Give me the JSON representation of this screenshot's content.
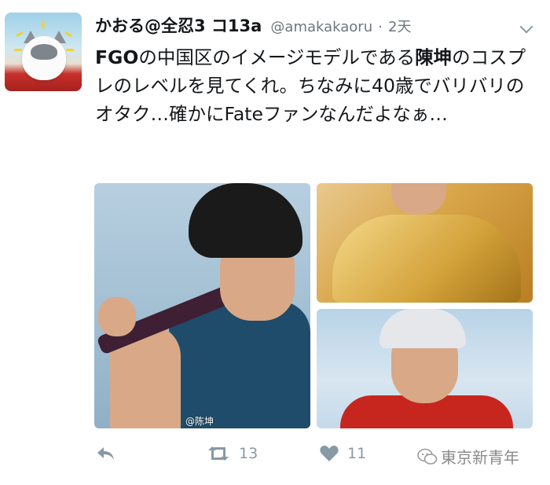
{
  "user": {
    "display_name": "かおる@全忍3 コ13a",
    "handle": "@amakakaoru",
    "separator": "·",
    "time": "2天"
  },
  "tweet": {
    "part1_bold": "FGO",
    "part2": "の中国区のイメージモデルである",
    "part3_bold": "陳坤",
    "part4": "のコスプレのレベルを見てくれ。ちなみに40歳でバリバリのオタク…確かにFateファンなんだよなぁ…"
  },
  "media": {
    "left_caption": "@陈坤",
    "images": [
      "cosplay-photo-main",
      "cosplay-photo-gold-armor",
      "cosplay-photo-red-coat"
    ]
  },
  "actions": {
    "retweet_count": "13",
    "like_count": "11"
  },
  "watermark": {
    "text": "東京新青年"
  },
  "colors": {
    "text": "#14171a",
    "muted": "#8899a6",
    "handle": "#6e767d"
  }
}
